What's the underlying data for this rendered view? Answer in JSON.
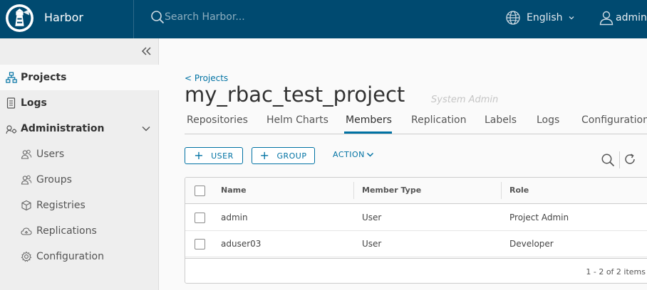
{
  "header": {
    "brand": "Harbor",
    "search_placeholder": "Search Harbor...",
    "language": "English",
    "user": "admin"
  },
  "sidebar": {
    "items": [
      {
        "label": "Projects",
        "icon": "projects-icon"
      },
      {
        "label": "Logs",
        "icon": "logs-icon"
      },
      {
        "label": "Administration",
        "icon": "wrench-icon"
      },
      {
        "label": "Users",
        "icon": "users-icon"
      },
      {
        "label": "Groups",
        "icon": "groups-icon"
      },
      {
        "label": "Registries",
        "icon": "cube-icon"
      },
      {
        "label": "Replications",
        "icon": "cloud-icon"
      },
      {
        "label": "Configuration",
        "icon": "gear-icon"
      }
    ]
  },
  "main": {
    "breadcrumb": "< Projects",
    "title": "my_rbac_test_project",
    "role": "System Admin",
    "tabs": [
      "Repositories",
      "Helm Charts",
      "Members",
      "Replication",
      "Labels",
      "Logs",
      "Configuration"
    ],
    "active_tab": "Members",
    "buttons": {
      "user": "USER",
      "group": "GROUP",
      "action": "ACTION"
    },
    "table": {
      "headers": [
        "Name",
        "Member Type",
        "Role"
      ],
      "rows": [
        [
          "admin",
          "User",
          "Project Admin"
        ],
        [
          "aduser03",
          "User",
          "Developer"
        ]
      ],
      "footer": "1 - 2 of 2 items"
    }
  },
  "colors": {
    "header_bg": "#004a70",
    "accent": "#0072a3",
    "sidebar_bg": "#eeeeee"
  }
}
